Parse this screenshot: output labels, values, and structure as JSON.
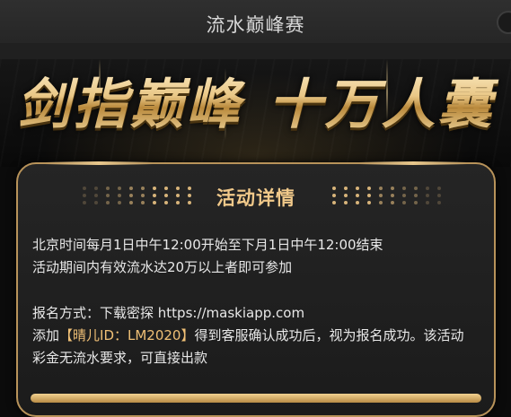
{
  "header": {
    "title": "流水巅峰赛"
  },
  "banner": {
    "part1": "剑指巅峰",
    "part2": "十万人囊"
  },
  "section": {
    "title": "活动详情"
  },
  "details": {
    "line1": "北京时间每月1日中午12:00开始至下月1日中午12:00结束",
    "line2": "活动期间内有效流水达20万以上者即可参加",
    "signup_label": "报名方式：",
    "signup_text": "下载密探 https://maskiapp.com",
    "contact_prefix": "添加",
    "contact_highlight": "【晴儿ID：LM2020】",
    "contact_suffix": "得到客服确认成功后，视为报名成功。该活动",
    "line_last": "彩金无流水要求，可直接出款"
  },
  "colors": {
    "gold": "#f0c076",
    "card_border": "#b8935a",
    "background": "#0b0b0b"
  }
}
